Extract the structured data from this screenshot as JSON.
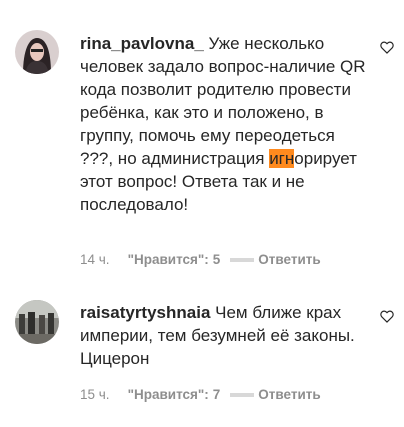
{
  "comments": [
    {
      "username": "rina_pavlovna_",
      "text_before": "Уже несколько человек задало вопрос-наличие QR кода позволит родителю провести ребёнка, как это и положено, в группу, помочь ему переодеться ???, но администрация ",
      "text_highlight": "игн",
      "text_after": "орирует этот вопрос! Ответа так и не последовало!",
      "time": "14 ч.",
      "likes_label": "\"Нравится\":",
      "likes_count": "5",
      "reply_label": "Ответить"
    },
    {
      "username": "raisatyrtyshnaia",
      "text": "Чем ближе крах империи, тем безумней её законы. Цицерон",
      "time": "15 ч.",
      "likes_label": "\"Нравится\":",
      "likes_count": "7",
      "reply_label": "Ответить"
    }
  ],
  "colors": {
    "highlight": "#ff8a1e",
    "meta_gray": "#8e8e8e",
    "text": "#262626"
  },
  "icons": {
    "like": "heart-outline-icon"
  }
}
